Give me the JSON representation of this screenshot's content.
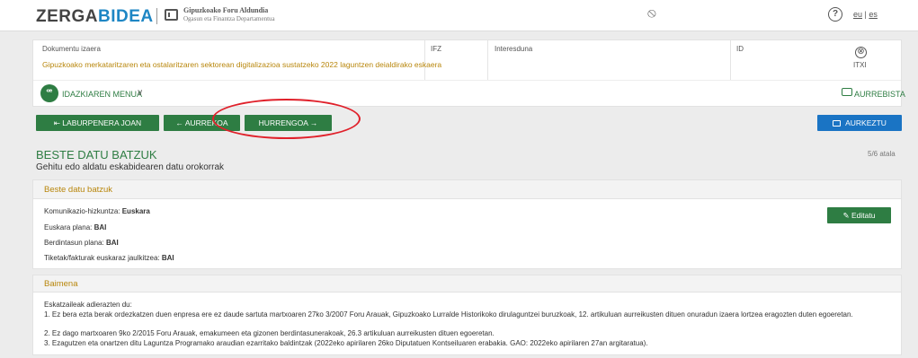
{
  "header": {
    "logo_main": "ZERGA",
    "logo_accent": "BIDEA",
    "gov_name": "Gipuzkoako Foru Aldundia",
    "gov_sub": "Ogasun eta Finantza Departamentua",
    "net_icon": "network-icon",
    "help_icon": "?",
    "lang_eu": "eu",
    "lang_sep": "|",
    "lang_es": "es"
  },
  "document": {
    "col_document": "Dokumentu izaera",
    "col_nif": "IFZ",
    "col_interested": "Interesduna",
    "col_id": "ID",
    "document_value": "Gipuzkoako merkataritzaren eta ostalaritzaren sektorean digitalizazioa sustatzeko 2022 laguntzen deialdirako eskaera",
    "close_symbol": "⊗",
    "close_label": "ITXI",
    "menu_label": "IDAZKIAREN MENUA",
    "menu_icon_char": "ꟹ",
    "menu_chevron": "∨",
    "print_label": "AURREBISTA"
  },
  "nav": {
    "summary_label": "⇤ LABURPENERA JOAN",
    "prev_label": "← AURREKOA",
    "next_label": "HURRENGOA →",
    "submit_label": "AURKEZTU"
  },
  "section": {
    "title": "BESTE DATU BATZUK",
    "subtitle": "Gehitu edo aldatu eskabidearen datu orokorrak",
    "step": "5/6 atala"
  },
  "other_data": {
    "title": "Beste datu batzuk",
    "edit_label": "✎ Editatu",
    "fields": [
      {
        "label": "Komunikazio-hizkuntza: ",
        "value": "Euskara"
      },
      {
        "label": "Euskara plana: ",
        "value": "BAI"
      },
      {
        "label": "Berdintasun plana: ",
        "value": "BAI"
      },
      {
        "label": "Tiketak/fakturak euskaraz jaulkitzea: ",
        "value": "BAI"
      }
    ]
  },
  "permission": {
    "title": "Baimena",
    "intro": "Eskatzaileak adierazten du:",
    "items": [
      "1. Ez bera ezta berak ordezkatzen duen enpresa ere ez daude sartuta martxoaren 27ko 3/2007 Foru Arauak, Gipuzkoako Lurralde Historikoko dirulaguntzei buruzkoak, 12. artikuluan aurreikusten dituen onuradun izaera lortzea eragozten duten egoeretan.",
      "2. Ez dago martxoaren 9ko 2/2015 Foru Arauak, emakumeen eta gizonen berdintasunerakoak, 26.3 artikuluan aurreikusten dituen egoeretan.",
      "3. Ezagutzen eta onartzen ditu Laguntza Programako araudian ezarritako baldintzak (2022eko apirilaren 26ko Diputatuen Kontseiluaren erabakia. GAO: 2022eko apirilaren 27an argitaratua)."
    ]
  },
  "colors": {
    "accent_green": "#2e7d43",
    "submit_blue": "#1a74c4",
    "title_gold": "#b8860b",
    "annotation_red": "#e0202a"
  }
}
